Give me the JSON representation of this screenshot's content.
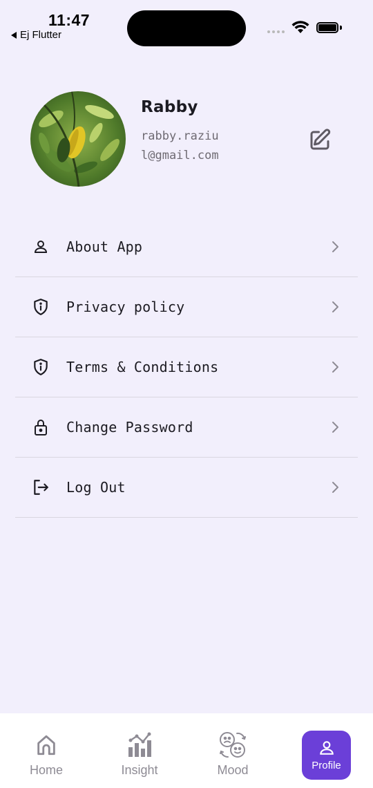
{
  "status_bar": {
    "time": "11:47",
    "back_app": "Ej Flutter"
  },
  "profile": {
    "name": "Rabby",
    "email": "rabby.raziul@gmail.com",
    "avatar_icon": "avatar-photo-leaves",
    "edit_icon": "edit-icon"
  },
  "menu": {
    "items": [
      {
        "label": "About App",
        "icon": "user-icon"
      },
      {
        "label": "Privacy policy",
        "icon": "shield-info-icon"
      },
      {
        "label": "Terms & Conditions",
        "icon": "shield-info-icon"
      },
      {
        "label": "Change Password",
        "icon": "lock-icon"
      },
      {
        "label": "Log Out",
        "icon": "logout-icon"
      }
    ]
  },
  "bottom_nav": {
    "items": [
      {
        "label": "Home",
        "icon": "home-icon",
        "active": false
      },
      {
        "label": "Insight",
        "icon": "chart-icon",
        "active": false
      },
      {
        "label": "Mood",
        "icon": "mood-icon",
        "active": false
      },
      {
        "label": "Profile",
        "icon": "profile-icon",
        "active": true
      }
    ]
  },
  "colors": {
    "background": "#F2EFFC",
    "accent": "#6B3FD8",
    "nav_background": "#FFFFFF",
    "inactive": "#8E8B94"
  }
}
